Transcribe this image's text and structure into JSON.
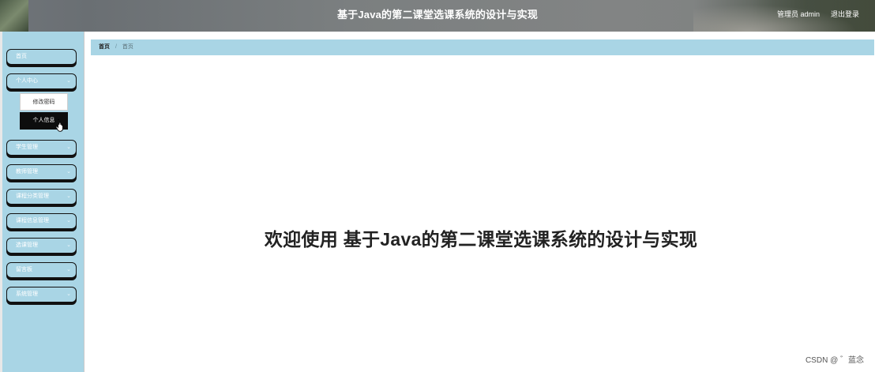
{
  "header": {
    "title": "基于Java的第二课堂选课系统的设计与实现",
    "user_label": "管理员 admin",
    "logout_label": "退出登录"
  },
  "sidebar": {
    "items": [
      {
        "label": "首页"
      },
      {
        "label": "个人中心",
        "chevron": "⌄",
        "submenu": [
          {
            "label": "修改密码"
          },
          {
            "label": "个人信息"
          }
        ]
      },
      {
        "label": "学生管理",
        "chevron": "⌄"
      },
      {
        "label": "教师管理",
        "chevron": "⌄"
      },
      {
        "label": "课程分类管理",
        "chevron": "⌄"
      },
      {
        "label": "课程信息管理",
        "chevron": "⌄"
      },
      {
        "label": "选课管理",
        "chevron": "⌄"
      },
      {
        "label": "留言板",
        "chevron": "⌄"
      },
      {
        "label": "系统管理",
        "chevron": "⌄"
      }
    ]
  },
  "breadcrumb": {
    "home": "首页",
    "separator": "/",
    "current": "首页"
  },
  "main": {
    "welcome": "欢迎使用 基于Java的第二课堂选课系统的设计与实现"
  },
  "watermark": "CSDN @ ゛蓝念",
  "icons": {
    "chevron": "chevron-down-icon",
    "cursor": "hand-pointer-icon"
  },
  "colors": {
    "accent": "#a9d5e5",
    "header": "#7b7f80",
    "submenu_active": "#0d0d0d"
  }
}
